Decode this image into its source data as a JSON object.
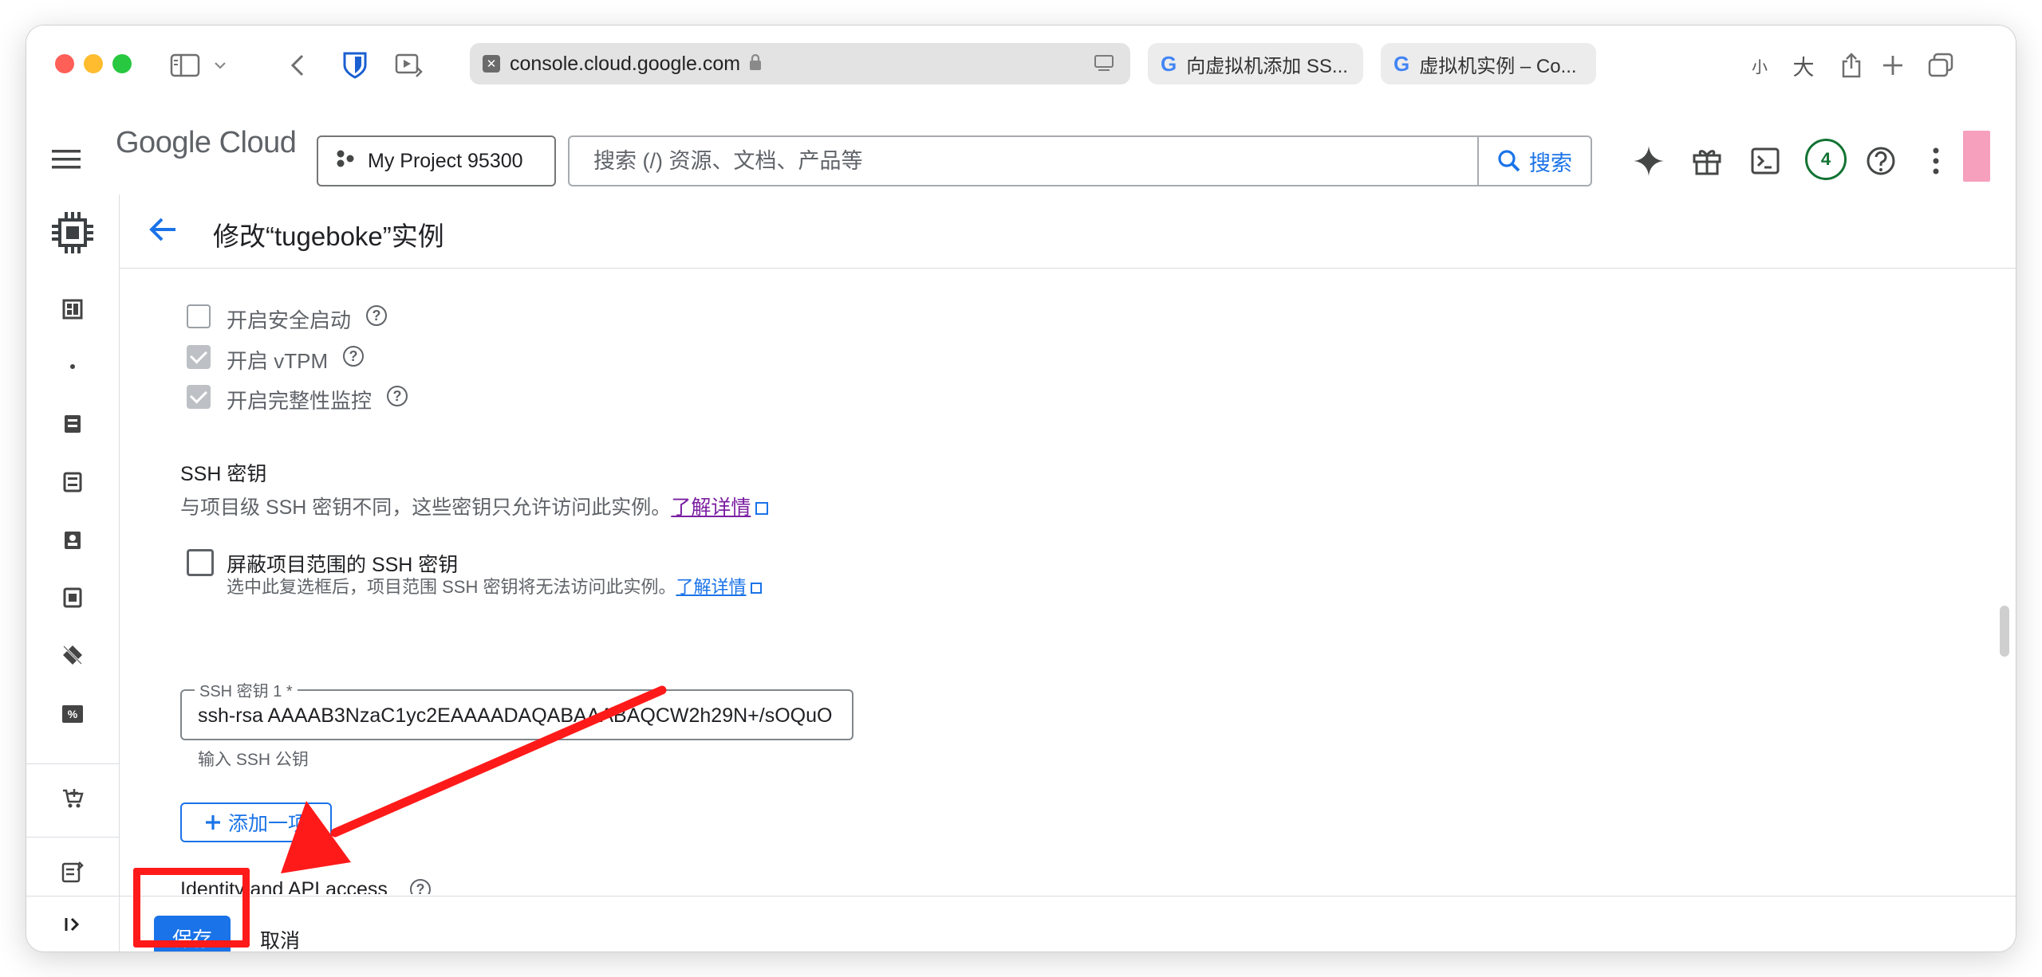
{
  "browser": {
    "url": "console.cloud.google.com",
    "tabs": [
      {
        "label": "向虚拟机添加 SS..."
      },
      {
        "label": "虚拟机实例 – Co..."
      }
    ],
    "text_small": "小",
    "text_large": "大"
  },
  "header": {
    "logo_google": "Google",
    "logo_cloud": "Cloud",
    "project": "My Project 95300",
    "search_placeholder": "搜索 (/) 资源、文档、产品等",
    "search_button": "搜索",
    "notification_count": "4"
  },
  "page": {
    "title": "修改“tugeboke”实例"
  },
  "security": {
    "secure_boot": "开启安全启动",
    "vtpm": "开启 vTPM",
    "integrity": "开启完整性监控"
  },
  "ssh": {
    "title": "SSH 密钥",
    "description": "与项目级 SSH 密钥不同，这些密钥只允许访问此实例。",
    "learn_more": "了解详情",
    "block_project_label": "屏蔽项目范围的 SSH 密钥",
    "block_project_desc": "选中此复选框后，项目范围 SSH 密钥将无法访问此实例。",
    "block_learn_more": "了解详情",
    "key_label": "SSH 密钥 1 *",
    "key_value": "ssh-rsa AAAAB3NzaC1yc2EAAAADAQABAAABAQCW2h29N+/sOQuO",
    "key_hint": "输入 SSH 公钥",
    "add_item": "添加一项"
  },
  "identity": {
    "title": "Identity and API access"
  },
  "footer": {
    "save": "保存",
    "cancel": "取消"
  },
  "colors": {
    "primary": "#1a73e8",
    "annotation": "#ff1a1a"
  }
}
